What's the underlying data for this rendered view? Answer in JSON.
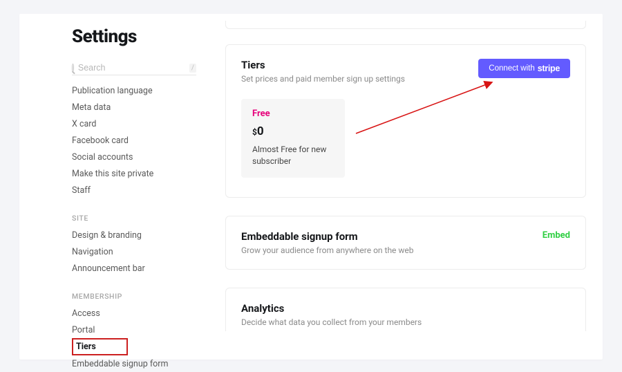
{
  "page": {
    "title": "Settings"
  },
  "search": {
    "placeholder": "Search",
    "kbd": "/"
  },
  "sidebar": {
    "group_top": {
      "items": [
        {
          "label": "Publication language"
        },
        {
          "label": "Meta data"
        },
        {
          "label": "X card"
        },
        {
          "label": "Facebook card"
        },
        {
          "label": "Social accounts"
        },
        {
          "label": "Make this site private"
        },
        {
          "label": "Staff"
        }
      ]
    },
    "group_site": {
      "label": "SITE",
      "items": [
        {
          "label": "Design & branding"
        },
        {
          "label": "Navigation"
        },
        {
          "label": "Announcement bar"
        }
      ]
    },
    "group_membership": {
      "label": "MEMBERSHIP",
      "items": [
        {
          "label": "Access"
        },
        {
          "label": "Portal"
        },
        {
          "label": "Tiers"
        },
        {
          "label": "Embeddable signup form"
        }
      ]
    }
  },
  "sections": {
    "tiers": {
      "title": "Tiers",
      "subtitle": "Set prices and paid member sign up settings",
      "button_prefix": "Connect with",
      "button_brand": "stripe",
      "tier": {
        "name": "Free",
        "currency": "$",
        "amount": "0",
        "desc": "Almost Free for new subscriber"
      }
    },
    "embed": {
      "title": "Embeddable signup form",
      "subtitle": "Grow your audience from anywhere on the web",
      "action": "Embed"
    },
    "analytics": {
      "title": "Analytics",
      "subtitle": "Decide what data you collect from your members"
    }
  }
}
